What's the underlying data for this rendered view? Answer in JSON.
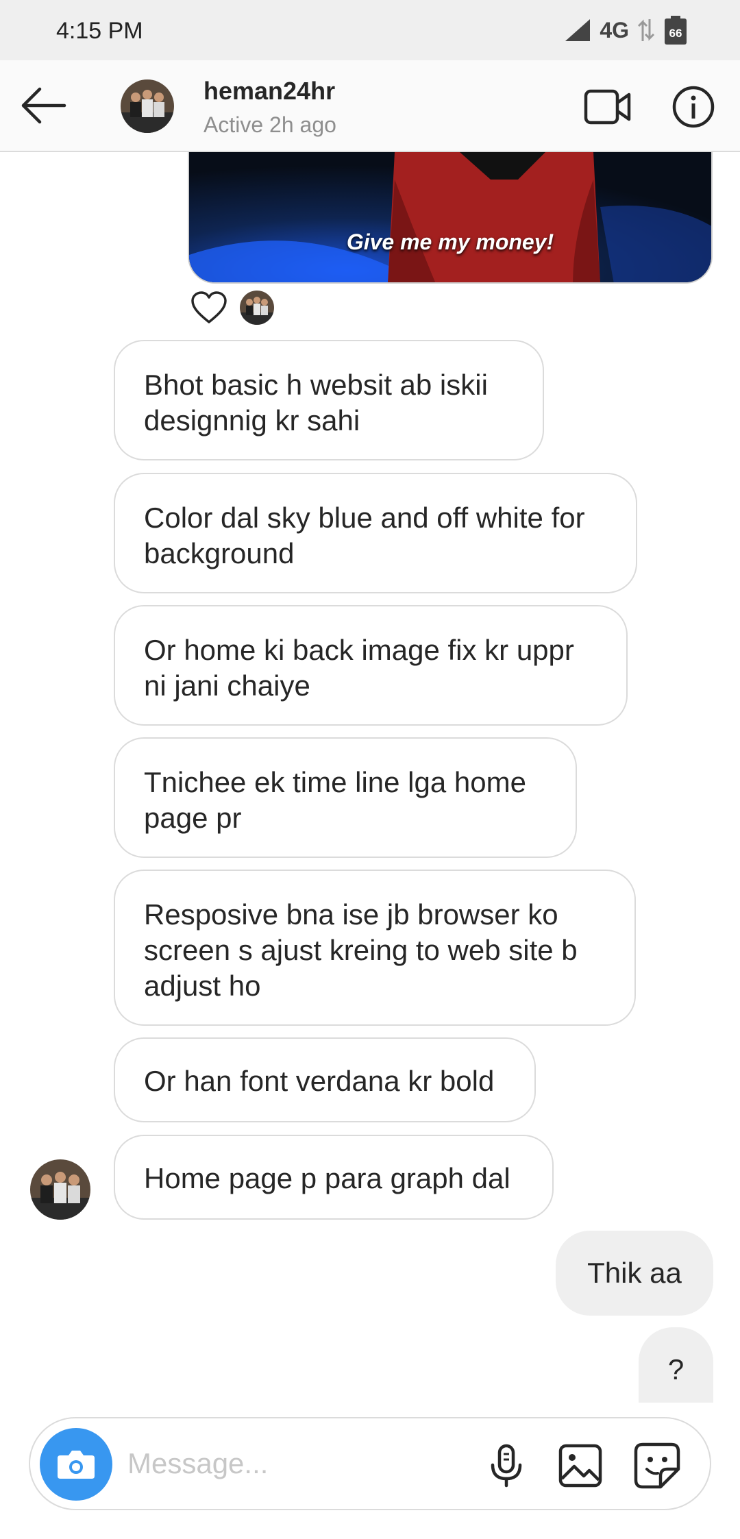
{
  "status_bar": {
    "time": "4:15 PM",
    "network": "4G",
    "battery": "66"
  },
  "header": {
    "username": "heman24hr",
    "status": "Active 2h ago"
  },
  "gif": {
    "caption": "Give me my money!"
  },
  "messages_incoming": [
    {
      "line1": "Bhot basic h websit ab iskii",
      "line2": "designnig kr sahi"
    },
    {
      "line1": "Color dal sky blue and off white for",
      "line2": "background"
    },
    {
      "line1": "Or home ki back image fix kr uppr",
      "line2": "ni jani chaiye"
    },
    {
      "line1": "Tnichee ek time line lga home",
      "line2": "page pr"
    },
    {
      "line1": "Resposive bna ise jb browser ko",
      "line2": "screen s ajust kreing to web site b",
      "line3": "adjust ho"
    },
    {
      "line1": "Or han font verdana kr bold"
    },
    {
      "line1": "Home page p para graph dal"
    }
  ],
  "messages_outgoing": [
    {
      "text": "Thik aa"
    },
    {
      "text": "?"
    }
  ],
  "composer": {
    "placeholder": "Message..."
  },
  "icons": {
    "back": "arrow-left-icon",
    "video": "video-camera-icon",
    "info": "info-icon",
    "heart": "heart-icon",
    "camera": "camera-icon",
    "mic": "microphone-icon",
    "gallery": "image-icon",
    "sticker": "sticker-icon"
  },
  "colors": {
    "accent": "#3897f0",
    "outgoing_bubble": "#efefef",
    "border": "#dbdbdb"
  }
}
